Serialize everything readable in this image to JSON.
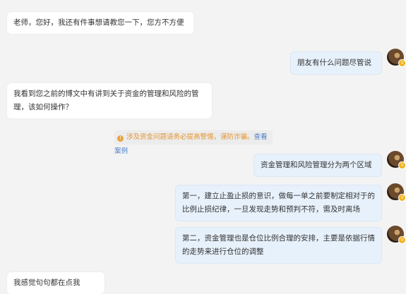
{
  "messages": [
    {
      "side": "left",
      "text": "老师，您好，我还有件事想请教您一下，您方不方便"
    },
    {
      "side": "right",
      "text": "朋友有什么问题尽管说"
    },
    {
      "side": "left",
      "text": "我看到您之前的博文中有讲到关于资金的管理和风险的管理，该如何操作？"
    },
    {
      "side": "right",
      "text": "资金管理和风险管理分为两个区域"
    },
    {
      "side": "right",
      "text": "第一，建立止盈止损的意识，做每一单之前要制定相对于的比例止损纪律，一旦发现走势和预判不符，需及时离场"
    },
    {
      "side": "right",
      "text": "第二，资金管理也是仓位比例合理的安排，主要是依据行情的走势来进行仓位的调整"
    },
    {
      "side": "left",
      "text": "我感觉句句都在点我"
    }
  ],
  "notice": {
    "icon": "warning-icon",
    "icon_glyph": "!",
    "warning_text": "涉及资金问题请务必提高警惕，谨防诈骗。",
    "link_text": "查看案例",
    "warning_color": "#e4952f",
    "link_color": "#4a7fc9"
  },
  "avatar": {
    "badge_glyph": "V"
  }
}
